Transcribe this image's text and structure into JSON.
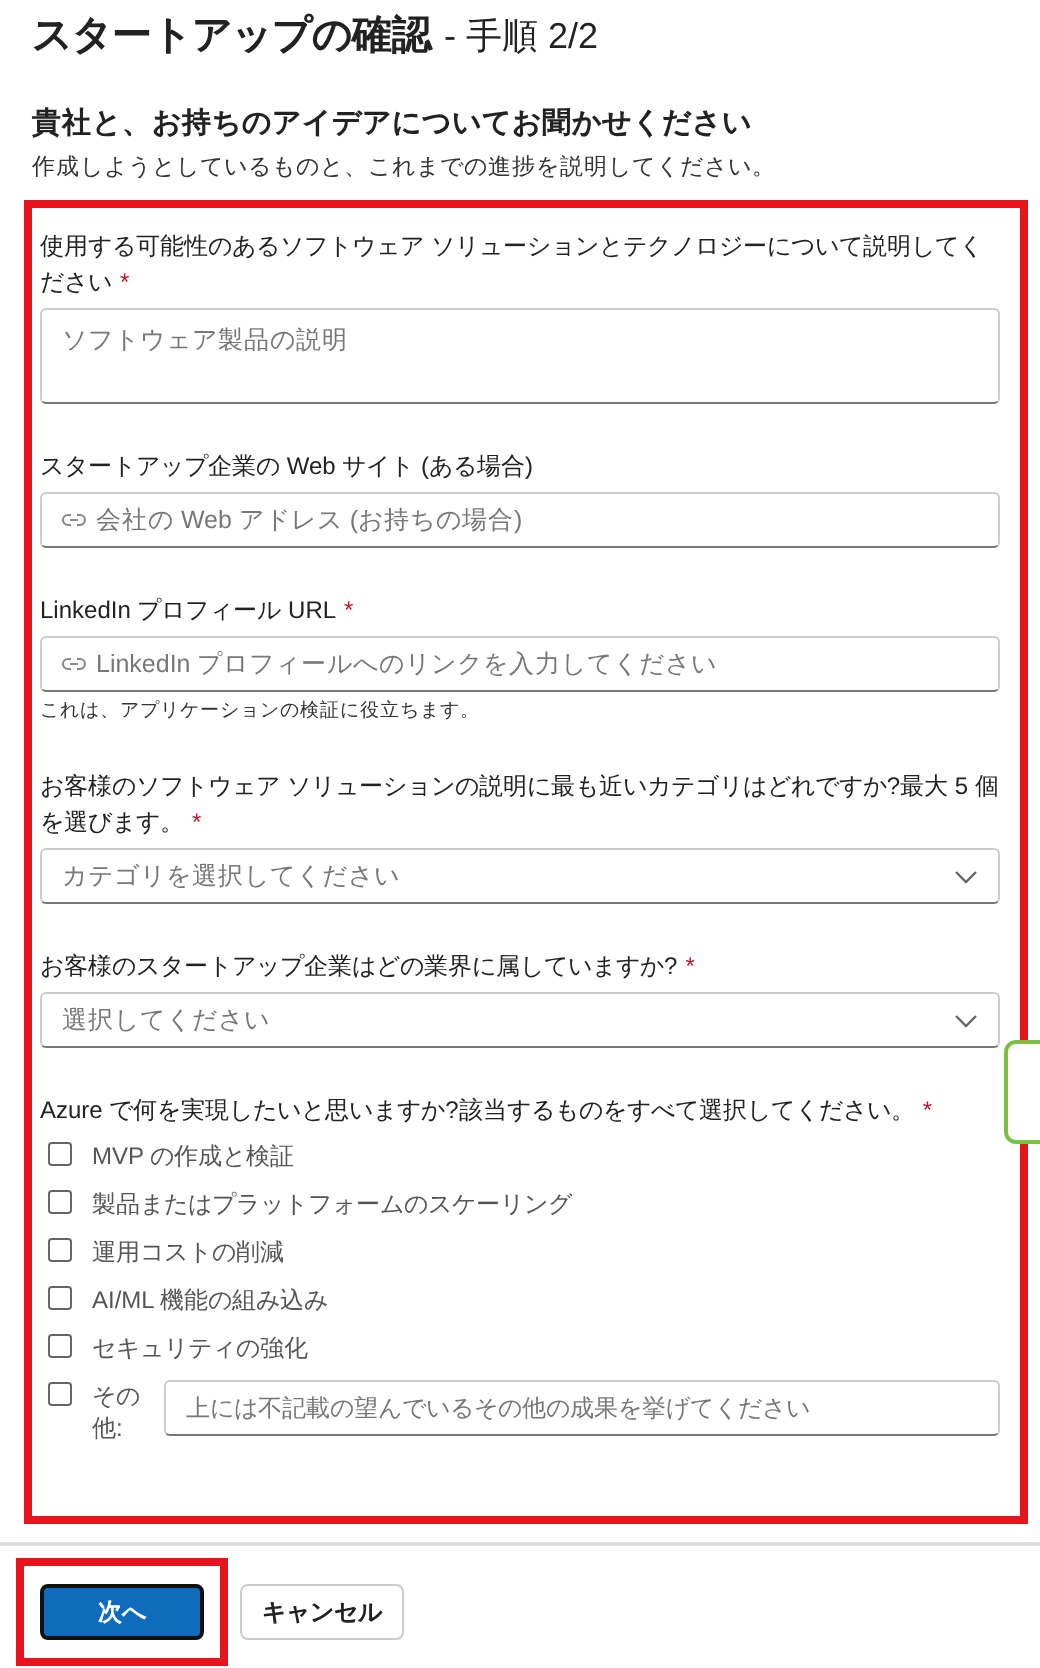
{
  "title": {
    "main": "スタートアップの確認",
    "step": "- 手順 2/2"
  },
  "heading": "貴社と、お持ちのアイデアについてお聞かせください",
  "subheading": "作成しようとしているものと、これまでの進捗を説明してください。",
  "form": {
    "highlighted": true,
    "fields": [
      {
        "kind": "textarea",
        "label": "使用する可能性のあるソフトウェア ソリューションとテクノロジーについて説明してください",
        "required_mark": "*",
        "placeholder": "ソフトウェア製品の説明"
      },
      {
        "kind": "url",
        "label": "スタートアップ企業の Web サイト (ある場合)",
        "placeholder": "会社の Web アドレス (お持ちの場合)"
      },
      {
        "kind": "url",
        "label": "LinkedIn プロフィール URL",
        "required_mark": "*",
        "placeholder": "LinkedIn プロフィールへのリンクを入力してください",
        "help": "これは、アプリケーションの検証に役立ちます。"
      },
      {
        "kind": "select",
        "label": "お客様のソフトウェア ソリューションの説明に最も近いカテゴリはどれですか?最大 5 個を選びます。",
        "required_mark": "*",
        "placeholder": "カテゴリを選択してください"
      },
      {
        "kind": "select",
        "label": "お客様のスタートアップ企業はどの業界に属していますか?",
        "required_mark": "*",
        "placeholder": "選択してください"
      },
      {
        "kind": "checkgroup",
        "label": "Azure で何を実現したいと思いますか?該当するものをすべて選択してください。",
        "required_mark": "*",
        "options": [
          {
            "label": "MVP の作成と検証",
            "checked": false
          },
          {
            "label": "製品またはプラットフォームのスケーリング",
            "checked": false
          },
          {
            "label": "運用コストの削減",
            "checked": false
          },
          {
            "label": "AI/ML 機能の組み込み",
            "checked": false
          },
          {
            "label": "セキュリティの強化",
            "checked": false
          },
          {
            "label": "その他:",
            "checked": false,
            "placeholder": "上には不記載の望んでいるその他の成果を挙げてください"
          }
        ]
      }
    ]
  },
  "buttons": [
    {
      "kind": "primary",
      "label": "次へ",
      "highlighted": true
    },
    {
      "kind": "secondary",
      "label": "キャンセル",
      "highlighted": false
    }
  ]
}
